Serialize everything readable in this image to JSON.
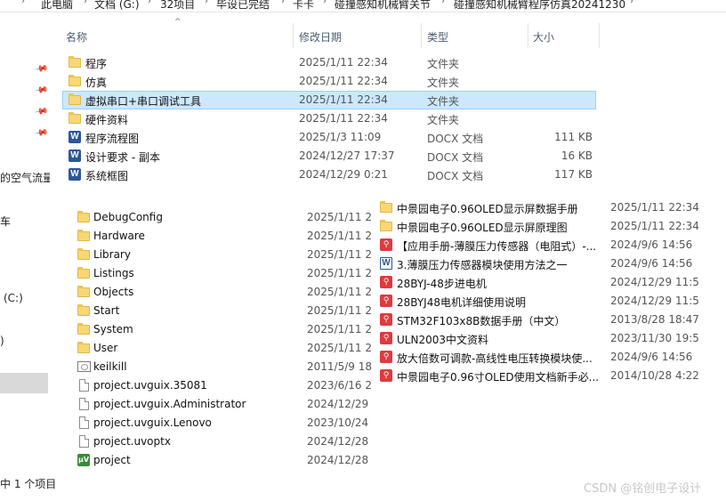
{
  "breadcrumb": [
    "此电脑",
    "文档 (G:)",
    "32项目",
    "毕设已完结",
    "卡卡",
    "碰撞感知机械臂关节",
    "碰撞感知机械臂程序仿真20241230"
  ],
  "nav": {
    "items": [
      "的空气流量",
      "车",
      "(C:)",
      ")"
    ]
  },
  "columns": {
    "name": "名称",
    "date": "修改日期",
    "type": "类型",
    "size": "大小"
  },
  "files": [
    {
      "icon": "folder-icon",
      "name": "程序",
      "date": "2025/1/11 22:34",
      "type": "文件夹",
      "size": ""
    },
    {
      "icon": "folder-icon",
      "name": "仿真",
      "date": "2025/1/11 22:34",
      "type": "文件夹",
      "size": ""
    },
    {
      "icon": "folder-icon",
      "name": "虚拟串口+串口调试工具",
      "date": "2025/1/11 22:34",
      "type": "文件夹",
      "size": "",
      "selected": true
    },
    {
      "icon": "folder-icon",
      "name": "硬件资料",
      "date": "2025/1/11 22:34",
      "type": "文件夹",
      "size": ""
    },
    {
      "icon": "word-icon",
      "name": "程序流程图",
      "date": "2025/1/3 11:09",
      "type": "DOCX 文档",
      "size": "111 KB"
    },
    {
      "icon": "word-icon",
      "name": "设计要求 - 副本",
      "date": "2024/12/27 17:37",
      "type": "DOCX 文档",
      "size": "16 KB"
    },
    {
      "icon": "word-icon",
      "name": "系统框图",
      "date": "2024/12/29 0:21",
      "type": "DOCX 文档",
      "size": "117 KB"
    }
  ],
  "project_files": [
    {
      "icon": "folder-icon",
      "name": "DebugConfig",
      "date": "2025/1/11 2"
    },
    {
      "icon": "folder-icon",
      "name": "Hardware",
      "date": "2025/1/11 2"
    },
    {
      "icon": "folder-icon",
      "name": "Library",
      "date": "2025/1/11 2"
    },
    {
      "icon": "folder-icon",
      "name": "Listings",
      "date": "2025/1/11 2"
    },
    {
      "icon": "folder-icon",
      "name": "Objects",
      "date": "2025/1/11 2"
    },
    {
      "icon": "folder-icon",
      "name": "Start",
      "date": "2025/1/11 2"
    },
    {
      "icon": "folder-icon",
      "name": "System",
      "date": "2025/1/11 2"
    },
    {
      "icon": "folder-icon",
      "name": "User",
      "date": "2025/1/11 2"
    },
    {
      "icon": "exe-icon",
      "name": "keilkill",
      "date": "2011/5/9 18"
    },
    {
      "icon": "file-icon",
      "name": "project.uvguix.35081",
      "date": "2023/6/16 2"
    },
    {
      "icon": "file-icon",
      "name": "project.uvguix.Administrator",
      "date": "2024/12/29"
    },
    {
      "icon": "file-icon",
      "name": "project.uvguix.Lenovo",
      "date": "2023/10/24"
    },
    {
      "icon": "file-icon",
      "name": "project.uvoptx",
      "date": "2024/12/28"
    },
    {
      "icon": "uvision-icon",
      "name": "project",
      "date": "2024/12/28"
    }
  ],
  "hardware_docs": [
    {
      "icon": "folder-icon",
      "name": "中景园电子0.96OLED显示屏数据手册",
      "date": "2025/1/11 22:34"
    },
    {
      "icon": "folder-icon",
      "name": "中景园电子0.96OLED显示屏原理图",
      "date": "2025/1/11 22:34"
    },
    {
      "icon": "pdf-icon",
      "name": "【应用手册-薄膜压力传感器（电阻式）-...",
      "date": "2024/9/6 14:56"
    },
    {
      "icon": "word-light-icon",
      "name": "3.薄膜压力传感器模块使用方法之一",
      "date": "2024/9/6 14:56"
    },
    {
      "icon": "pdf-icon",
      "name": "28BYJ-48步进电机",
      "date": "2024/12/29 11:5"
    },
    {
      "icon": "pdf-icon",
      "name": "28BYJ48电机详细使用说明",
      "date": "2024/12/29 11:5"
    },
    {
      "icon": "pdf-icon",
      "name": "STM32F103x8B数据手册（中文）",
      "date": "2013/8/28 18:47"
    },
    {
      "icon": "pdf-icon",
      "name": "ULN2003中文资料",
      "date": "2023/11/30 19:5"
    },
    {
      "icon": "pdf-icon",
      "name": "放大倍数可调款-高线性电压转换模块使...",
      "date": "2024/9/6 14:56"
    },
    {
      "icon": "pdf-icon",
      "name": "中景园电子0.96寸OLED使用文档新手必...",
      "date": "2014/10/28 4:22"
    }
  ],
  "status": "中 1 个项目",
  "watermark": "CSDN @铭创电子设计"
}
